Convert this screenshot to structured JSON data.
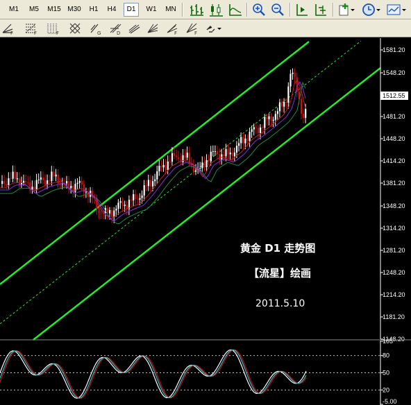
{
  "toolbar": {
    "timeframes": [
      "M1",
      "M5",
      "M15",
      "M30",
      "H1",
      "H4",
      "D1",
      "W1",
      "MN"
    ],
    "active_timeframe": "D1",
    "icons": [
      "bar-chart-icon",
      "candlestick-icon",
      "line-chart-icon",
      "zoom-in-icon",
      "zoom-out-icon",
      "chart-shift-icon",
      "autoscroll-icon",
      "new-order-icon",
      "clock-icon",
      "templates-icon"
    ]
  },
  "drawing_tools": {
    "icons": [
      "fibo-fan-icon",
      "fibo-retracement-icon",
      "grid-icon",
      "hatched-icon",
      "gann-grid-icon",
      "cross-icon",
      "andrews-pitchfork-icon",
      "gann-fan-icon",
      "regression-icon",
      "arrows-dropdown-icon"
    ]
  },
  "main_chart": {
    "price_ticks": [
      "1581.20",
      "1548.20",
      "1481.20",
      "1448.20",
      "1414.20",
      "1381.20",
      "1348.20",
      "1314.20",
      "1281.20",
      "1248.20",
      "1214.20",
      "1181.20",
      "1148.20"
    ],
    "current_price": "1512.55",
    "current_price_color": "#ffffff",
    "caption_line1": "黄金 D1 走势图",
    "caption_line2": "【流星】绘画",
    "caption_date": "2011.5.10",
    "channel_color": "#22ee22",
    "bull_color": "#ffffff",
    "bear_color": "#cc1111"
  },
  "oscillator": {
    "ticks": [
      "105",
      "80",
      "50",
      "20",
      "-5.00"
    ],
    "levels": [
      80,
      50,
      20
    ]
  }
}
